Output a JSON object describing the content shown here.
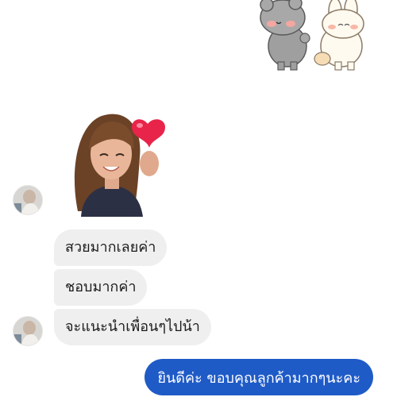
{
  "stickers": {
    "top_right": "bears-sticker",
    "memoji": "memoji-heart-sticker"
  },
  "messages_incoming": [
    "สวยมากเลยค่า",
    "ชอบมากค่า",
    "จะแนะนำเพื่อนๆไปน้า"
  ],
  "message_outgoing": "ยินดีค่ะ ขอบคุณลูกค้ามากๆนะคะ",
  "colors": {
    "incoming_bubble": "#efefef",
    "outgoing_bubble": "#1f5bc7",
    "background": "#ffffff"
  }
}
